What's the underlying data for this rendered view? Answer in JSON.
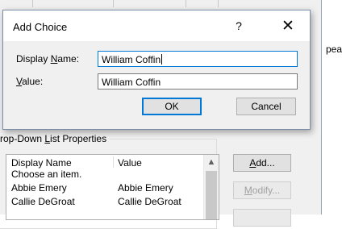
{
  "background": {
    "doc_text": "pear",
    "group_title_prefix": "rop-Down ",
    "group_title_accel": "L",
    "group_title_rest": "ist Properties",
    "list": {
      "header_name": "Display Name",
      "header_value": "Value",
      "scroll_up_icon": "▲",
      "rows": [
        {
          "name": "Choose an item.",
          "value": ""
        },
        {
          "name": "Abbie Emery",
          "value": "Abbie Emery"
        },
        {
          "name": "Callie DeGroat",
          "value": "Callie DeGroat"
        }
      ]
    },
    "buttons": {
      "add_accel": "A",
      "add_rest": "dd...",
      "modify_accel": "M",
      "modify_rest": "odify..."
    }
  },
  "dialog": {
    "title": "Add Choice",
    "help": "?",
    "close": "✕",
    "display_name_prefix": "Display ",
    "display_name_accel": "N",
    "display_name_rest": "ame:",
    "display_name_value": "William Coffin",
    "value_accel": "V",
    "value_rest": "alue:",
    "value_value": "William Coffin",
    "ok": "OK",
    "cancel": "Cancel"
  }
}
